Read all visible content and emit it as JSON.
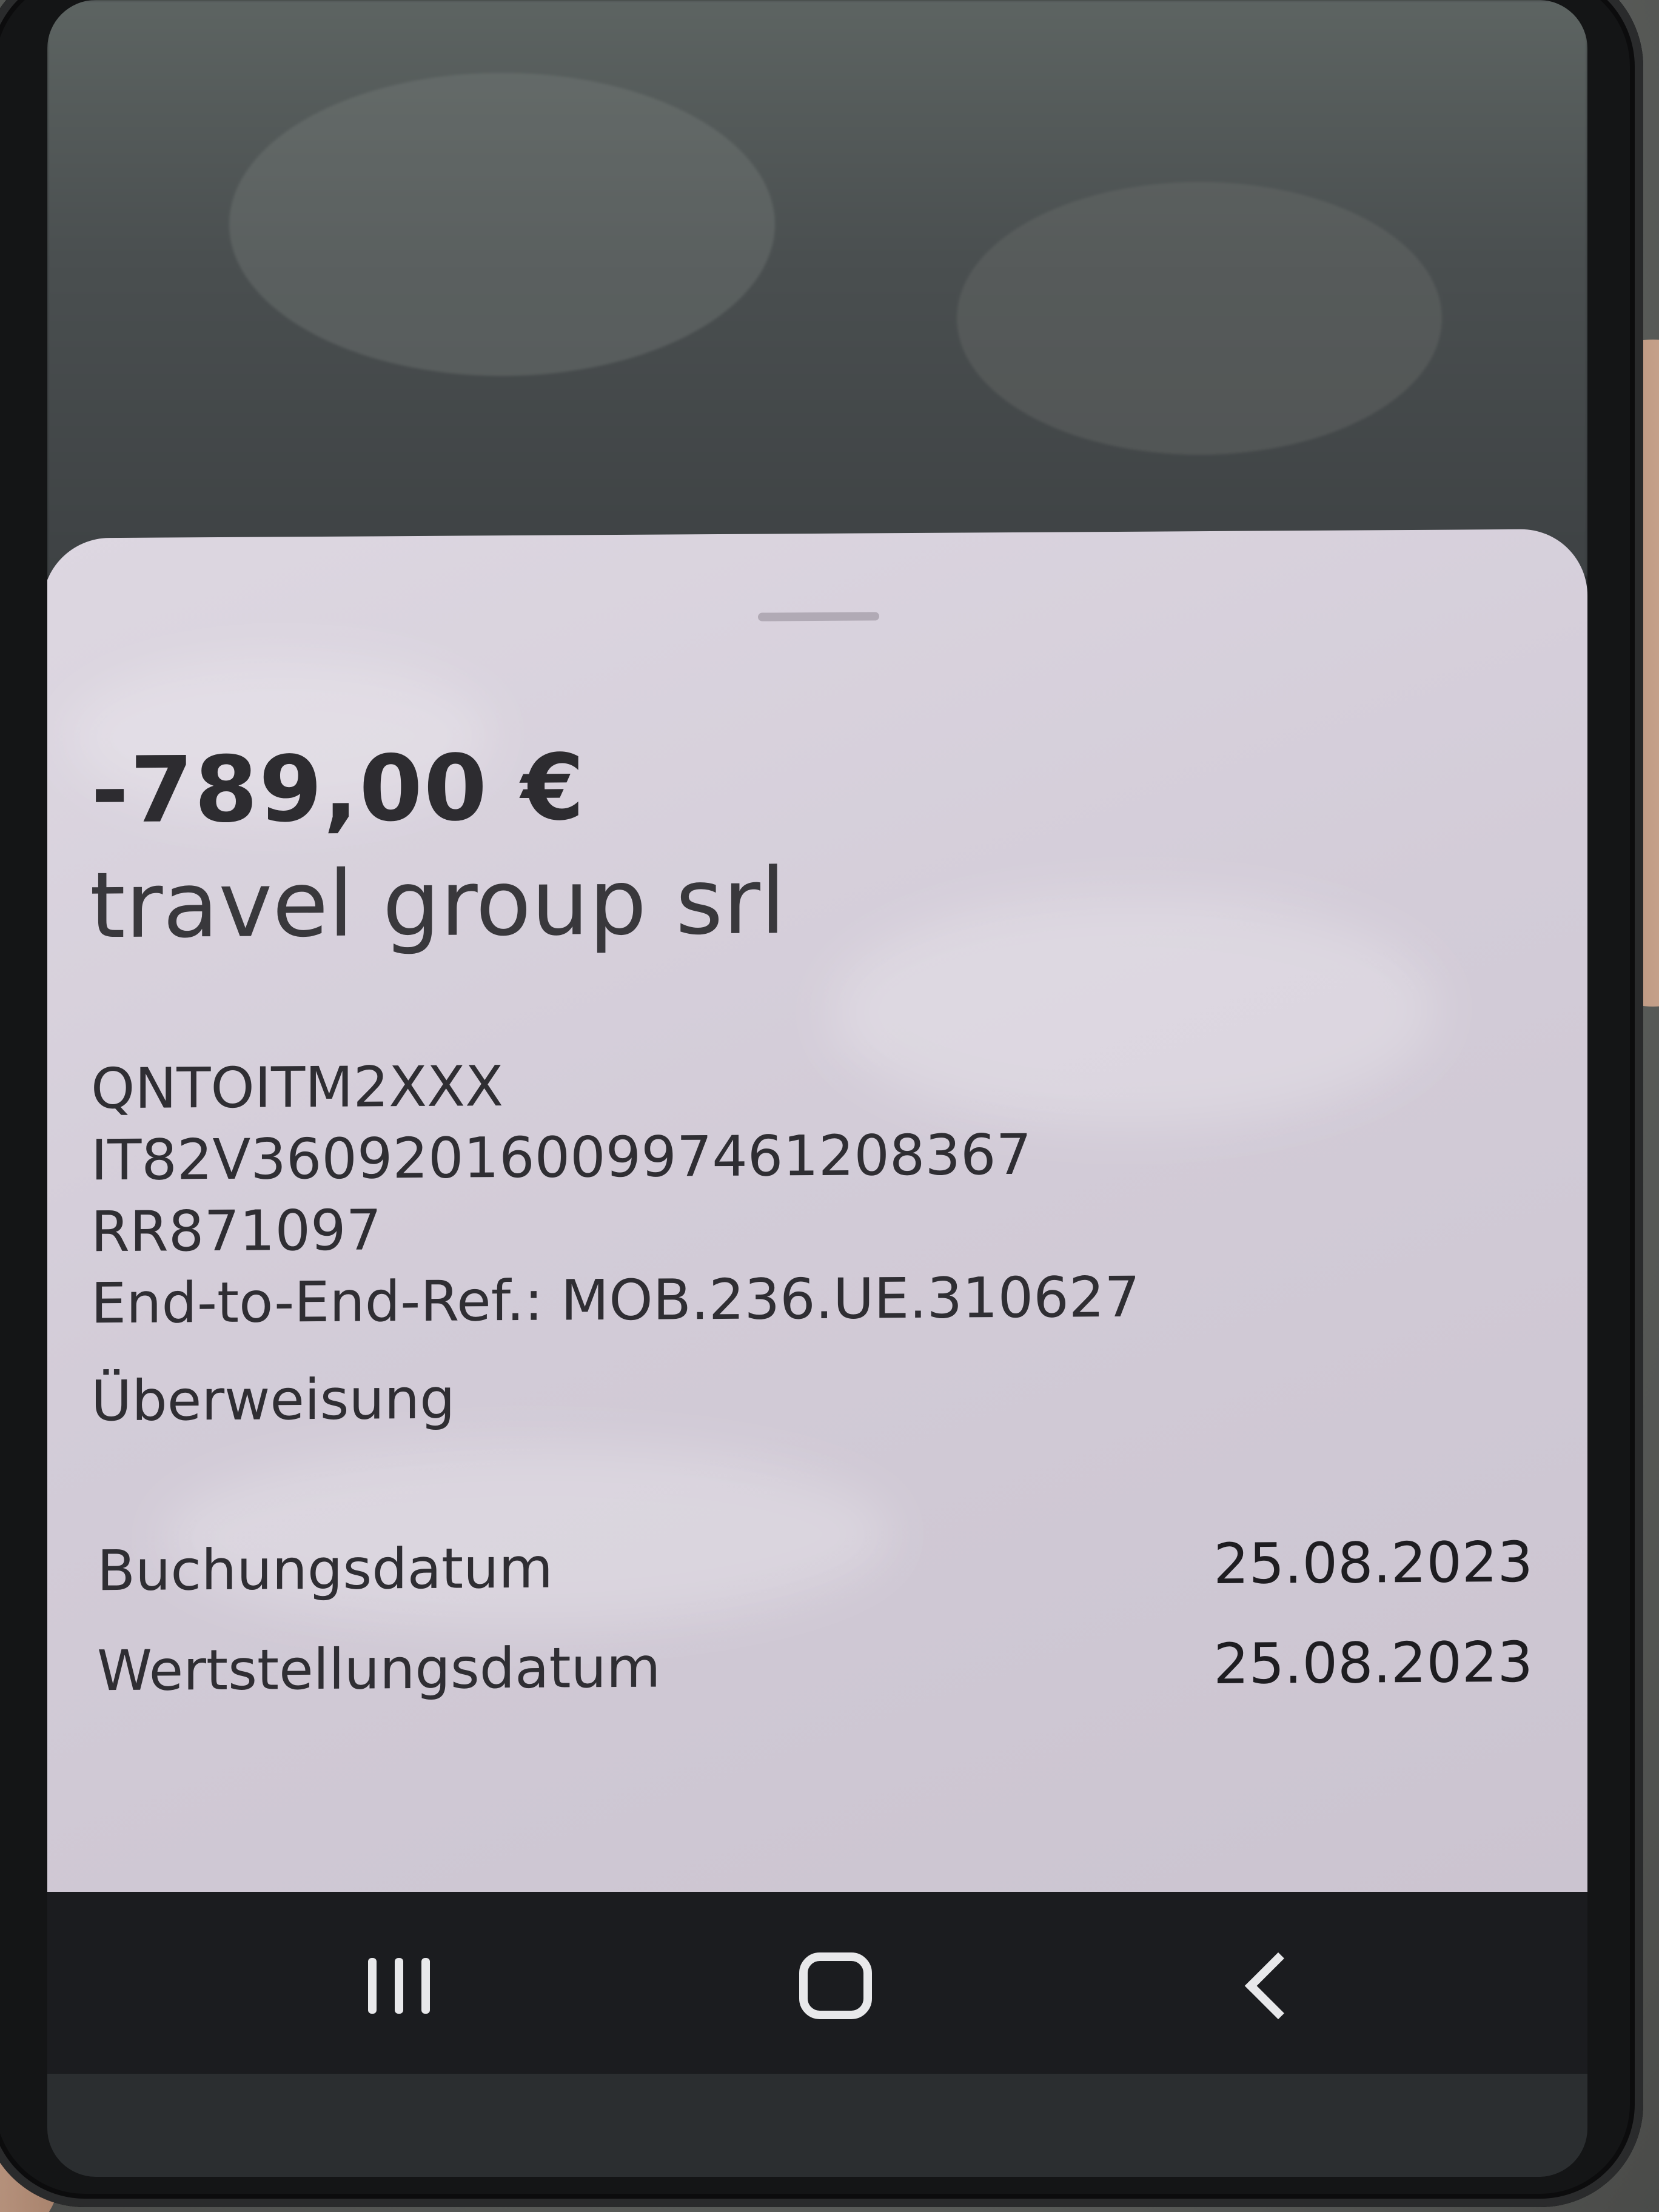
{
  "transaction": {
    "amount": "-789,00 €",
    "payee": "travel group srl",
    "bic": "QNTOITM2XXX",
    "iban": "IT82V3609201600997461208367",
    "reference": "RR871097",
    "end_to_end_ref": "End-to-End-Ref.: MOB.236.UE.310627",
    "type": "Überweisung"
  },
  "dates": {
    "booking_label": "Buchungsdatum",
    "booking_value": "25.08.2023",
    "value_label": "Wertstellungsdatum",
    "value_value": "25.08.2023"
  },
  "navbar": {
    "recents_icon": "recent-apps-icon",
    "home_icon": "home-icon",
    "back_icon": "back-icon"
  },
  "colors": {
    "sheet_background": "#d6cfdb",
    "text_primary": "#2d2c30",
    "navbar_background": "#1b1c1f"
  }
}
